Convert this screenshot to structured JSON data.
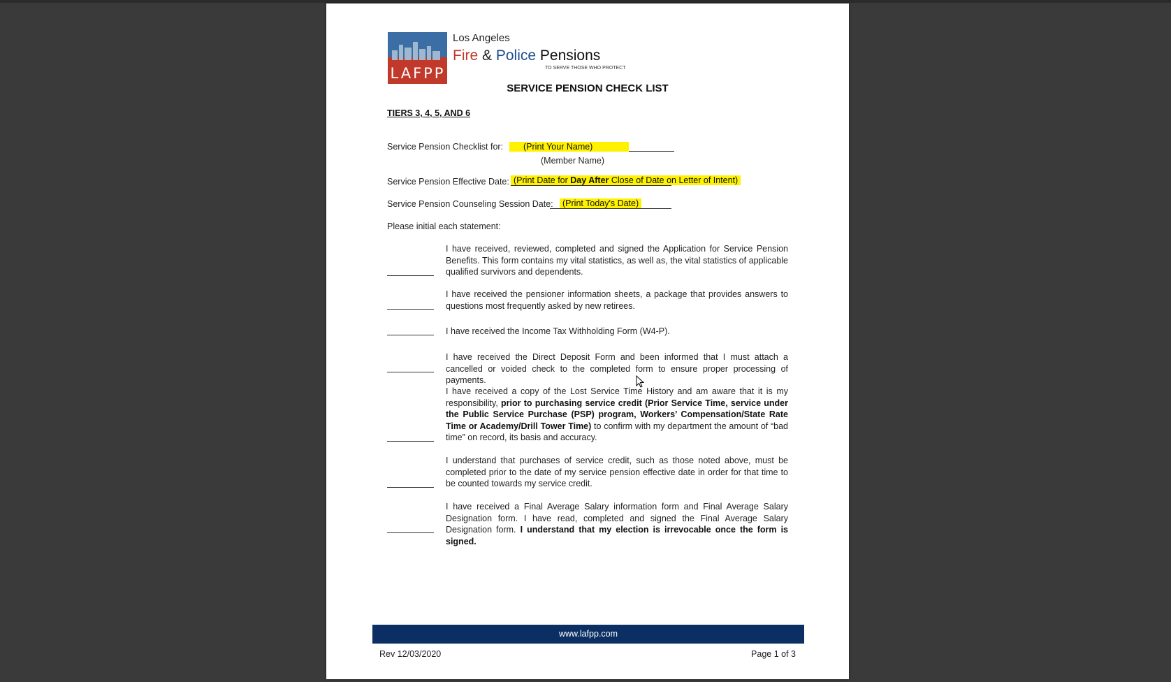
{
  "header": {
    "logo_text": "LAFPP",
    "city": "Los Angeles",
    "name_fire": "Fire",
    "name_amp": " & ",
    "name_police": "Police",
    "name_pensions": " Pensions",
    "tagline": "TO SERVE THOSE WHO PROTECT"
  },
  "title": "SERVICE PENSION CHECK LIST",
  "tiers": "TIERS 3, 4, 5, AND 6",
  "fields": {
    "checklist_for_label": "Service Pension Checklist for:",
    "checklist_for_value": "(Print Your  Name)",
    "member_name_caption": "(Member Name)",
    "effective_date_label": "Service Pension Effective Date:",
    "effective_date_pre": "(Print Date for ",
    "effective_date_bold": "Day After",
    "effective_date_post": " Close of Date on Letter of Intent)",
    "counseling_label": "Service Pension Counseling Session Date:",
    "counseling_value": "(Print Today's Date)"
  },
  "instruction": "Please initial each statement:",
  "statements": {
    "s1": "I have received, reviewed, completed and signed the Application for Service Pension Benefits.  This form contains my vital statistics, as well as, the vital statistics of applicable qualified survivors and dependents.",
    "s2": "I have received the pensioner information sheets, a package that provides answers to questions most frequently asked by new retirees.",
    "s3": "I have received the Income Tax Withholding Form (W4-P).",
    "s4": "I have received the Direct Deposit Form and been informed that I must attach a cancelled or voided check to the completed form to ensure proper processing of payments.",
    "s5_a": "I have received a copy of the Lost Service Time History and am aware that it is my responsibility, ",
    "s5_b": "prior to purchasing service credit (Prior Service Time, service under the Public Service Purchase (PSP) program, Workers’ Compensation/State Rate Time or Academy/Drill Tower Time)",
    "s5_c": " to confirm with my department the amount of “bad time” on record, its basis and accuracy.",
    "s6": "I understand that purchases of service credit, such as those noted above, must be completed prior to the date of my service pension effective date in order for that time to be counted towards my service credit.",
    "s7_a": "I have received a Final Average Salary information form and Final Average Salary Designation form.  I have read, completed and signed the Final Average Salary Designation form.  ",
    "s7_b": "I understand that my election is irrevocable once the form is signed."
  },
  "footer": {
    "url": "www.lafpp.com",
    "revision": "Rev 12/03/2020",
    "page": "Page 1 of 3"
  },
  "colors": {
    "highlight": "#fff200",
    "footer_bar": "#0b2f63",
    "fire_red": "#c0392b",
    "police_blue": "#1f4e8c"
  },
  "icons": {
    "cursor": "mouse-pointer-icon"
  }
}
